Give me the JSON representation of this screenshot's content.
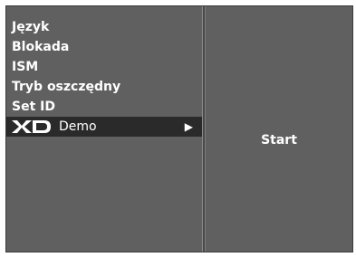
{
  "menu": {
    "items": [
      {
        "label": "Język"
      },
      {
        "label": "Blokada"
      },
      {
        "label": "ISM"
      },
      {
        "label": "Tryb oszczędny"
      },
      {
        "label": "Set ID"
      }
    ],
    "selected": {
      "logo_icon": "xd-logo-icon",
      "logo_text": "XD",
      "label": "Demo",
      "arrow_icon": "right-arrow-icon",
      "arrow_glyph": "▶"
    }
  },
  "submenu": {
    "option": "Start"
  },
  "colors": {
    "panel_bg": "#606060",
    "selected_bg": "#2a2a2a",
    "text": "#ffffff"
  }
}
